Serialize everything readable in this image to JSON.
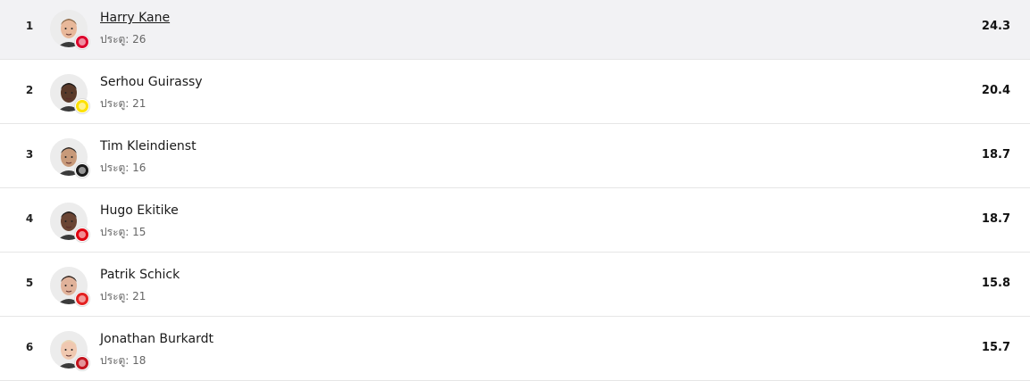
{
  "stats_label": "ประตู:",
  "players": [
    {
      "rank": "1",
      "name": "Harry Kane",
      "goals": "26",
      "value": "24.3",
      "club_icon": "bayern-munich-crest-icon",
      "club_color": "#dc052d",
      "skin": "#e8b89a",
      "hair": "#8a6a4a"
    },
    {
      "rank": "2",
      "name": "Serhou Guirassy",
      "goals": "21",
      "value": "20.4",
      "club_icon": "borussia-dortmund-crest-icon",
      "club_color": "#fde100",
      "skin": "#5a3a2a",
      "hair": "#1a1a1a"
    },
    {
      "rank": "3",
      "name": "Tim Kleindienst",
      "goals": "16",
      "value": "18.7",
      "club_icon": "gladbach-crest-icon",
      "club_color": "#1a1a1a",
      "skin": "#c89a7a",
      "hair": "#2a2a2a"
    },
    {
      "rank": "4",
      "name": "Hugo Ekitike",
      "goals": "15",
      "value": "18.7",
      "club_icon": "eintracht-frankfurt-crest-icon",
      "club_color": "#e1000f",
      "skin": "#6a4534",
      "hair": "#1a1a1a"
    },
    {
      "rank": "5",
      "name": "Patrik Schick",
      "goals": "21",
      "value": "15.8",
      "club_icon": "bayer-leverkusen-crest-icon",
      "club_color": "#e32221",
      "skin": "#e0b29a",
      "hair": "#2a2220"
    },
    {
      "rank": "6",
      "name": "Jonathan Burkardt",
      "goals": "18",
      "value": "15.7",
      "club_icon": "mainz-05-crest-icon",
      "club_color": "#c3141e",
      "skin": "#f0c8b0",
      "hair": "#e8d8b8"
    }
  ]
}
